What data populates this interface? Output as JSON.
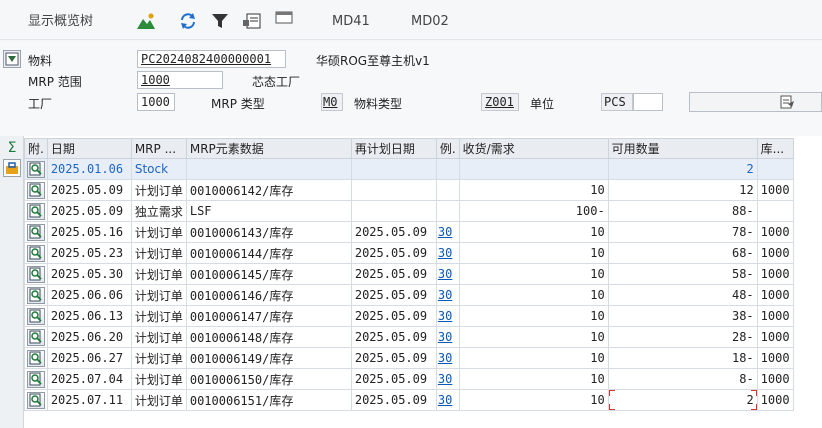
{
  "toolbar": {
    "title": "显示概览树",
    "md41": "MD41",
    "md02": "MD02"
  },
  "header": {
    "material_label": "物料",
    "material_value": "PC2024082400000001",
    "material_desc": "华硕ROG至尊主机v1",
    "mrp_area_label": "MRP 范围",
    "mrp_area_value": "1000",
    "mrp_area_desc": "芯态工厂",
    "plant_label": "工厂",
    "plant_value": "1000",
    "mrp_type_label": "MRP 类型",
    "mrp_type_value": "M0",
    "material_type_label": "物料类型",
    "material_type_value": "Z001",
    "unit_label": "单位",
    "unit_value": "PCS",
    "unit_extra": ""
  },
  "grid": {
    "columns": [
      "附.",
      "日期",
      "MRP ...",
      "MRP元素数据",
      "再计划日期",
      "例.",
      "收货/需求",
      "可用数量",
      "库..."
    ],
    "rows": [
      {
        "date": "2025.01.06",
        "mrp": "Stock",
        "data": "",
        "resched": "",
        "ex": "",
        "qty": "",
        "avail": "2",
        "stor": ""
      },
      {
        "date": "2025.05.09",
        "mrp": "计划订单",
        "data": "0010006142/库存",
        "resched": "",
        "ex": "",
        "qty": "10",
        "avail": "12",
        "stor": "1000"
      },
      {
        "date": "2025.05.09",
        "mrp": "独立需求",
        "data": "LSF",
        "resched": "",
        "ex": "",
        "qty": "100-",
        "avail": "88-",
        "stor": ""
      },
      {
        "date": "2025.05.16",
        "mrp": "计划订单",
        "data": "0010006143/库存",
        "resched": "2025.05.09",
        "ex": "30",
        "qty": "10",
        "avail": "78-",
        "stor": "1000"
      },
      {
        "date": "2025.05.23",
        "mrp": "计划订单",
        "data": "0010006144/库存",
        "resched": "2025.05.09",
        "ex": "30",
        "qty": "10",
        "avail": "68-",
        "stor": "1000"
      },
      {
        "date": "2025.05.30",
        "mrp": "计划订单",
        "data": "0010006145/库存",
        "resched": "2025.05.09",
        "ex": "30",
        "qty": "10",
        "avail": "58-",
        "stor": "1000"
      },
      {
        "date": "2025.06.06",
        "mrp": "计划订单",
        "data": "0010006146/库存",
        "resched": "2025.05.09",
        "ex": "30",
        "qty": "10",
        "avail": "48-",
        "stor": "1000"
      },
      {
        "date": "2025.06.13",
        "mrp": "计划订单",
        "data": "0010006147/库存",
        "resched": "2025.05.09",
        "ex": "30",
        "qty": "10",
        "avail": "38-",
        "stor": "1000"
      },
      {
        "date": "2025.06.20",
        "mrp": "计划订单",
        "data": "0010006148/库存",
        "resched": "2025.05.09",
        "ex": "30",
        "qty": "10",
        "avail": "28-",
        "stor": "1000"
      },
      {
        "date": "2025.06.27",
        "mrp": "计划订单",
        "data": "0010006149/库存",
        "resched": "2025.05.09",
        "ex": "30",
        "qty": "10",
        "avail": "18-",
        "stor": "1000"
      },
      {
        "date": "2025.07.04",
        "mrp": "计划订单",
        "data": "0010006150/库存",
        "resched": "2025.05.09",
        "ex": "30",
        "qty": "10",
        "avail": "8-",
        "stor": "1000"
      },
      {
        "date": "2025.07.11",
        "mrp": "计划订单",
        "data": "0010006151/库存",
        "resched": "2025.05.09",
        "ex": "30",
        "qty": "10",
        "avail": "2",
        "stor": "1000"
      }
    ]
  },
  "colors": {
    "link": "#0a58b8",
    "stock_blue": "#1e66c2",
    "highlight_red": "#d9342b"
  },
  "icons": [
    "mountain-chart-icon",
    "refresh-icon",
    "filter-icon",
    "layout-config-icon",
    "window-icon",
    "toggle-header-icon",
    "details-icon",
    "sum-icon",
    "bag-icon",
    "row-detail-icon"
  ]
}
